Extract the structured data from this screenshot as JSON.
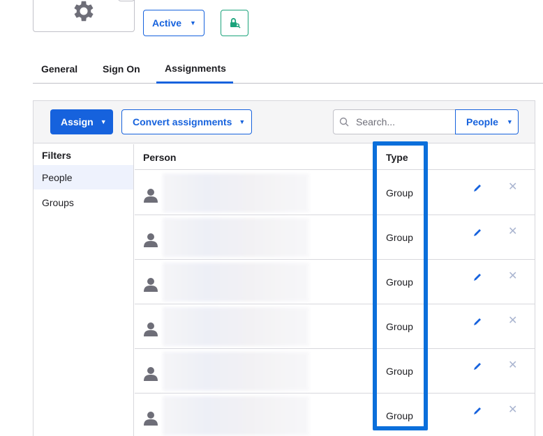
{
  "header": {
    "status_label": "Active"
  },
  "icons": {
    "app_logo": "gear-icon",
    "lock": "lock-key-icon",
    "search": "search-icon",
    "person": "person-icon",
    "edit": "pencil-icon",
    "remove": "close-icon",
    "caret": "caret-down-icon"
  },
  "colors": {
    "primary": "#1662dd",
    "success": "#1ba37b",
    "highlight": "#0b6fdb"
  },
  "tabs": [
    {
      "label": "General"
    },
    {
      "label": "Sign On"
    },
    {
      "label": "Assignments",
      "active": true
    }
  ],
  "toolbar": {
    "assign_label": "Assign",
    "convert_label": "Convert assignments",
    "search_placeholder": "Search...",
    "people_select_label": "People"
  },
  "filters": {
    "title": "Filters",
    "items": [
      {
        "label": "People",
        "active": true
      },
      {
        "label": "Groups"
      }
    ]
  },
  "table": {
    "columns": {
      "person": "Person",
      "type": "Type"
    },
    "rows": [
      {
        "type": "Group"
      },
      {
        "type": "Group"
      },
      {
        "type": "Group"
      },
      {
        "type": "Group"
      },
      {
        "type": "Group"
      },
      {
        "type": "Group"
      }
    ]
  }
}
